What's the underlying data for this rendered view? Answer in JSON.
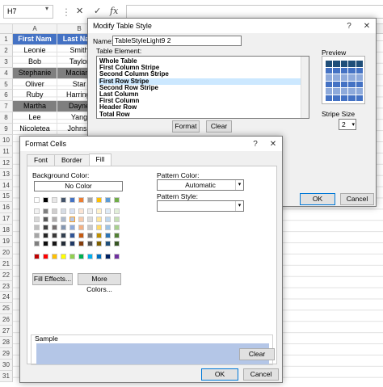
{
  "excel": {
    "namebox": "H7",
    "formula_icons": [
      "close-icon",
      "check-icon",
      "fx-icon"
    ],
    "columns": [
      "A",
      "B"
    ],
    "row_numbers": [
      "1",
      "2",
      "3",
      "4",
      "5",
      "6",
      "7",
      "8",
      "9",
      "10",
      "11",
      "12",
      "13",
      "14",
      "15",
      "16",
      "17",
      "18",
      "19",
      "20",
      "21",
      "22",
      "23",
      "24",
      "25",
      "26",
      "27",
      "28",
      "29",
      "30",
      "31"
    ],
    "table_header": [
      "First Nam",
      "Last Nam"
    ],
    "table_rows": [
      [
        "Leonie",
        "Smith"
      ],
      [
        "Bob",
        "Taylor"
      ],
      [
        "Stephanie",
        "Macianz"
      ],
      [
        "Oliver",
        "Star"
      ],
      [
        "Ruby",
        "Harringt"
      ],
      [
        "Martha",
        "Dayne"
      ],
      [
        "Lee",
        "Yang"
      ],
      [
        "Nicoletea",
        "Johnso"
      ]
    ],
    "header_color": "#4472c4",
    "stripe_color": "#7f7f7f"
  },
  "modify_table_style": {
    "title": "Modify Table Style",
    "name_label": "Name:",
    "name_value": "TableStyleLight9 2",
    "table_element_label": "Table Element:",
    "elements": [
      "Whole Table",
      "First Column Stripe",
      "Second Column Stripe",
      "First Row Stripe",
      "Second Row Stripe",
      "Last Column",
      "First Column",
      "Header Row",
      "Total Row"
    ],
    "selected_element": "First Row Stripe",
    "format_button": "Format",
    "clear_button": "Clear",
    "preview_label": "Preview",
    "stripe_size_label": "Stripe Size",
    "stripe_size_value": "2",
    "ok_button": "OK",
    "cancel_button": "Cancel",
    "help_icon": "?",
    "close_icon": "✕"
  },
  "format_cells": {
    "title": "Format Cells",
    "tabs": [
      "Font",
      "Border",
      "Fill"
    ],
    "active_tab": "Fill",
    "background_color_label": "Background Color:",
    "no_color_button": "No Color",
    "pattern_color_label": "Pattern Color:",
    "pattern_color_value": "Automatic",
    "pattern_style_label": "Pattern Style:",
    "pattern_style_value": "",
    "fill_effects_button": "Fill Effects...",
    "more_colors_button": "More Colors...",
    "sample_label": "Sample",
    "sample_color": "#b4c6e7",
    "clear_button": "Clear",
    "ok_button": "OK",
    "cancel_button": "Cancel",
    "help_icon": "?",
    "close_icon": "✕",
    "theme_colors_top": [
      "#ffffff",
      "#000000",
      "#e7e6e6",
      "#44546a",
      "#4472c4",
      "#ed7d31",
      "#a5a5a5",
      "#ffc000",
      "#5b9bd5",
      "#70ad47"
    ],
    "theme_tints": [
      [
        "#f2f2f2",
        "#7f7f7f",
        "#d0cece",
        "#d6dce4",
        "#d9e2f3",
        "#fbe5d5",
        "#ededed",
        "#fff2cc",
        "#deebf6",
        "#e2efd9"
      ],
      [
        "#d8d8d8",
        "#595959",
        "#aeabab",
        "#adb9ca",
        "#b4c6e7",
        "#f7cbac",
        "#dbdbdb",
        "#fee599",
        "#bdd7ee",
        "#c5e0b3"
      ],
      [
        "#bfbfbf",
        "#3f3f3f",
        "#757070",
        "#8496b0",
        "#8eaadb",
        "#f4b183",
        "#c9c9c9",
        "#ffd965",
        "#9cc3e5",
        "#a8d08d"
      ],
      [
        "#a5a5a5",
        "#262626",
        "#3a3838",
        "#323f4f",
        "#2f5496",
        "#c55a11",
        "#7b7b7b",
        "#bf9000",
        "#2e75b5",
        "#538135"
      ],
      [
        "#7f7f7f",
        "#0c0c0c",
        "#171616",
        "#222a35",
        "#1f3864",
        "#833c0b",
        "#525252",
        "#7f6000",
        "#1e4e79",
        "#375623"
      ]
    ],
    "standard_colors": [
      "#c00000",
      "#ff0000",
      "#ffc000",
      "#ffff00",
      "#92d050",
      "#00b050",
      "#00b0f0",
      "#0070c0",
      "#002060",
      "#7030a0"
    ],
    "selected_swatch": "#b4c6e7"
  }
}
